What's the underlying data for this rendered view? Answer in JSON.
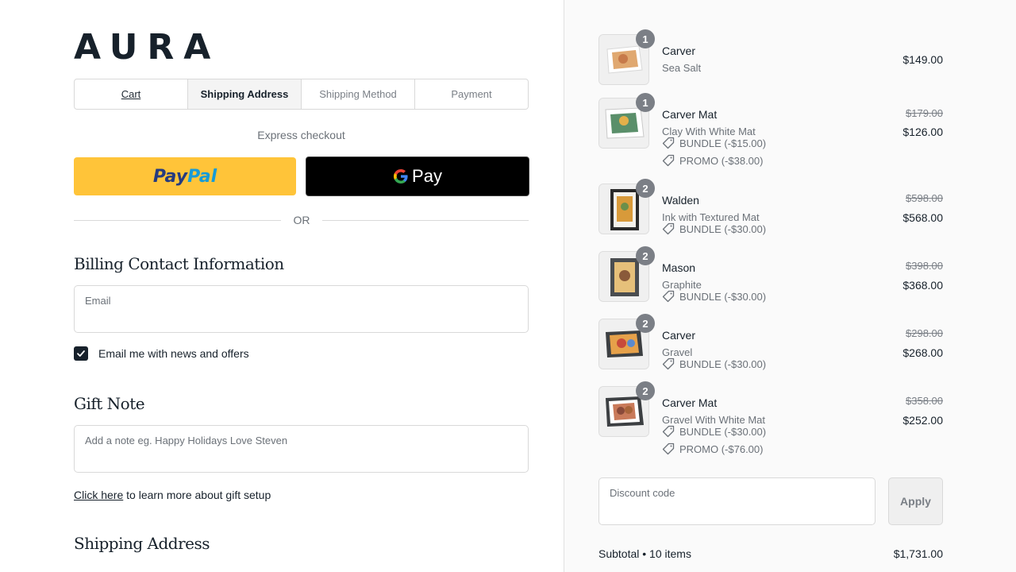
{
  "brand": {
    "logo": "AURA"
  },
  "steps": [
    {
      "label": "Cart"
    },
    {
      "label": "Shipping Address"
    },
    {
      "label": "Shipping Method"
    },
    {
      "label": "Payment"
    }
  ],
  "express": {
    "label": "Express checkout",
    "paypal": {
      "part1": "Pay",
      "part2": "Pal"
    },
    "gpay": {
      "label": "Pay"
    },
    "or": "OR"
  },
  "billing": {
    "title": "Billing Contact Information",
    "email_label": "Email",
    "newsletter_label": "Email me with news and offers",
    "newsletter_checked": true
  },
  "gift": {
    "title": "Gift Note",
    "placeholder": "Add a note eg. Happy Holidays Love Steven",
    "link_text": "Click here",
    "link_suffix": " to learn more about gift setup"
  },
  "shipping": {
    "title": "Shipping Address"
  },
  "cart": {
    "items": [
      {
        "qty": "1",
        "name": "Carver",
        "variant": "Sea Salt",
        "price": "$149.00",
        "discounts": []
      },
      {
        "qty": "1",
        "name": "Carver Mat",
        "variant": "Clay With White Mat",
        "original": "$179.00",
        "price": "$126.00",
        "discounts": [
          "BUNDLE (-$15.00)",
          "PROMO (-$38.00)"
        ]
      },
      {
        "qty": "2",
        "name": "Walden",
        "variant": "Ink with Textured Mat",
        "original": "$598.00",
        "price": "$568.00",
        "discounts": [
          "BUNDLE (-$30.00)"
        ]
      },
      {
        "qty": "2",
        "name": "Mason",
        "variant": "Graphite",
        "original": "$398.00",
        "price": "$368.00",
        "discounts": [
          "BUNDLE (-$30.00)"
        ]
      },
      {
        "qty": "2",
        "name": "Carver",
        "variant": "Gravel",
        "original": "$298.00",
        "price": "$268.00",
        "discounts": [
          "BUNDLE (-$30.00)"
        ]
      },
      {
        "qty": "2",
        "name": "Carver Mat",
        "variant": "Gravel With White Mat",
        "original": "$358.00",
        "price": "$252.00",
        "discounts": [
          "BUNDLE (-$30.00)",
          "PROMO (-$76.00)"
        ]
      }
    ],
    "discount_label": "Discount code",
    "apply_label": "Apply",
    "subtotal_label": "Subtotal • 10 items",
    "subtotal_value": "$1,731.00"
  },
  "colors": {
    "paypal_yellow": "#ffc439",
    "brand_dark": "#17212b",
    "sidebar_bg": "#fafafa"
  }
}
